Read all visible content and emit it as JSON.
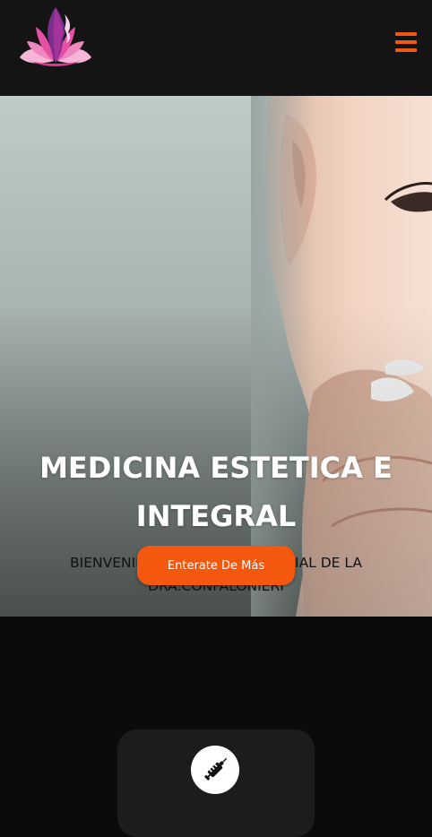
{
  "header": {
    "logo_icon": "lotus-face-logo",
    "menu_icon": "hamburger-menu-icon"
  },
  "hero": {
    "title": "MEDICINA ESTETICA E INTEGRAL",
    "subtitle": "BIENVENIDOS A LA PAGINA OFICIAL DE LA DRA.CONFALONIERI",
    "cta_label": "Enterate De Más"
  },
  "services": {
    "card_icon": "syringe-icon"
  },
  "colors": {
    "accent": "#f4580e",
    "header_bg": "#141414",
    "page_bg": "#0b0b0b",
    "card_bg": "#1c1c1c"
  }
}
